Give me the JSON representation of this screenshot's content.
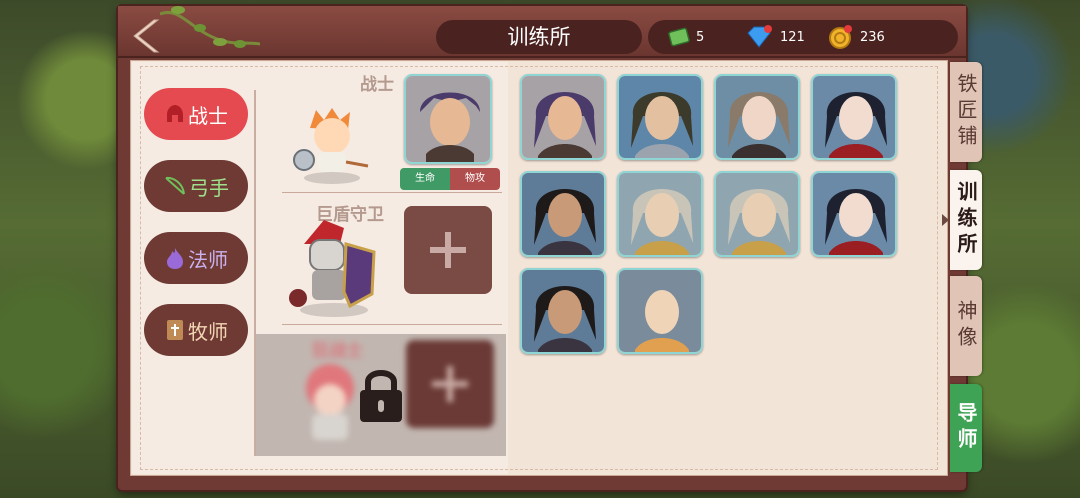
{
  "header": {
    "title": "训练所",
    "resources": [
      {
        "icon": "scroll-icon",
        "value": "5"
      },
      {
        "icon": "diamond-icon",
        "value": "121"
      },
      {
        "icon": "gold-coin-icon",
        "value": "236"
      }
    ]
  },
  "classes": [
    {
      "label": "战士",
      "icon": "helmet-icon",
      "active": true
    },
    {
      "label": "弓手",
      "icon": "bow-icon",
      "active": false
    },
    {
      "label": "法师",
      "icon": "flame-icon",
      "active": false
    },
    {
      "label": "牧师",
      "icon": "book-icon",
      "active": false
    }
  ],
  "slots": [
    {
      "name": "战士",
      "tags": [
        "生命",
        "物攻"
      ]
    },
    {
      "name": "巨盾守卫"
    },
    {
      "name": "狂战士",
      "locked": true
    }
  ],
  "side_tabs": [
    {
      "label": "铁匠铺"
    },
    {
      "label": "训练所",
      "active": true
    },
    {
      "label": "神像"
    },
    {
      "label": "导师"
    }
  ],
  "heroes_grid": [
    {
      "name": "purple-hair-warrior"
    },
    {
      "name": "armored-knight"
    },
    {
      "name": "veiled-lady"
    },
    {
      "name": "dark-hair-swordswoman"
    },
    {
      "name": "dark-ponytail-man"
    },
    {
      "name": "silver-hair-man"
    },
    {
      "name": "silver-hair-man-2"
    },
    {
      "name": "dark-hair-swordswoman-2"
    },
    {
      "name": "dark-ponytail-man-2"
    },
    {
      "name": "bald-monk"
    }
  ]
}
